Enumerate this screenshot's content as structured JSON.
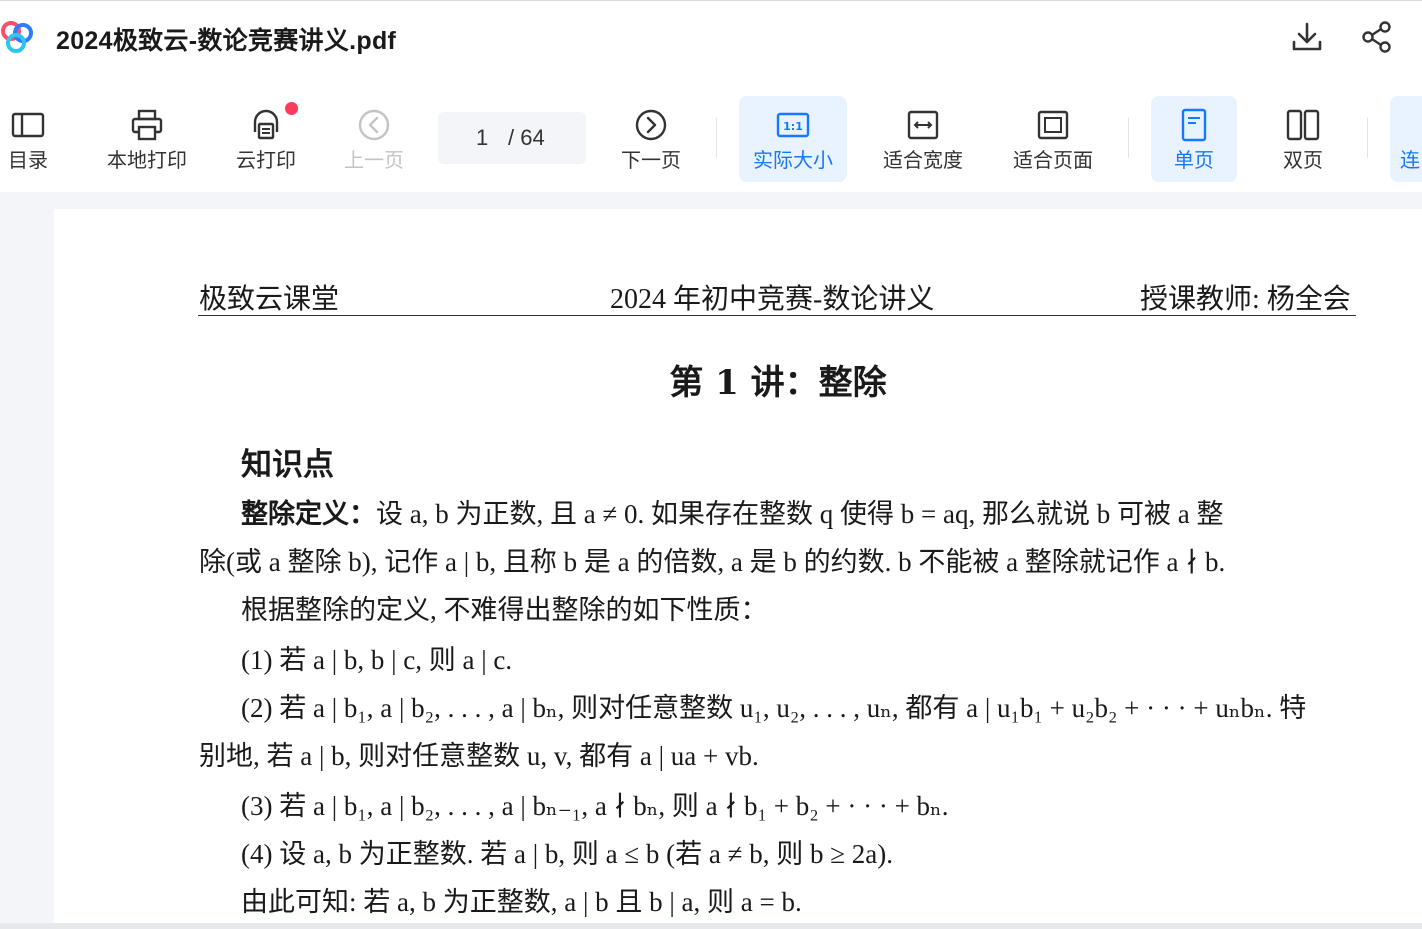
{
  "titlebar": {
    "doc_title": "2024极致云-数论竞赛讲义.pdf",
    "logo_icon": "baidu-netdisk-logo-icon",
    "download_icon": "download-icon",
    "share_icon": "share-icon"
  },
  "toolbar": {
    "toc_label": "目录",
    "local_print_label": "本地打印",
    "cloud_print_label": "云打印",
    "prev_label": "上一页",
    "page_current": "1",
    "page_total": "/ 64",
    "next_label": "下一页",
    "actual_size_label": "实际大小",
    "fit_width_label": "适合宽度",
    "fit_page_label": "适合页面",
    "single_label": "单页",
    "double_label": "双页",
    "continuous_label": "连",
    "accent_color": "#1677ff",
    "badge_color": "#ff3b5c"
  },
  "document": {
    "header_left": "极致云课堂",
    "header_center": "2024 年初中竞赛-数论讲义",
    "header_right": "授课教师: 杨全会",
    "lecture_title": "第 1 讲：整除",
    "section_title": "知识点",
    "def_label": "整除定义：",
    "lines": {
      "l1": "设 a, b 为正数, 且 a ≠ 0. 如果存在整数 q 使得 b = aq, 那么就说 b 可被 a 整",
      "l2": "除(或 a 整除 b), 记作 a | b, 且称 b 是 a 的倍数, a 是 b 的约数. b 不能被 a 整除就记作 a ∤ b.",
      "l3": "根据整除的定义, 不难得出整除的如下性质：",
      "l4": "(1) 若 a | b, b | c, 则 a | c.",
      "l5": "(2) 若 a | b₁, a | b₂, . . . , a | bₙ, 则对任意整数 u₁, u₂, . . . , uₙ, 都有 a | u₁b₁ + u₂b₂ + · · · + uₙbₙ. 特",
      "l6": "别地, 若 a | b, 则对任意整数 u, v, 都有 a | ua + vb.",
      "l7": "(3) 若 a | b₁, a | b₂, . . . , a | bₙ₋₁, a ∤ bₙ, 则 a ∤ b₁ + b₂ + · · · + bₙ.",
      "l8": "(4) 设 a, b 为正整数. 若 a | b, 则 a ≤ b (若 a ≠ b, 则 b ≥ 2a).",
      "l9": "由此可知: 若 a, b 为正整数, a | b 且 b | a, 则 a = b."
    }
  }
}
